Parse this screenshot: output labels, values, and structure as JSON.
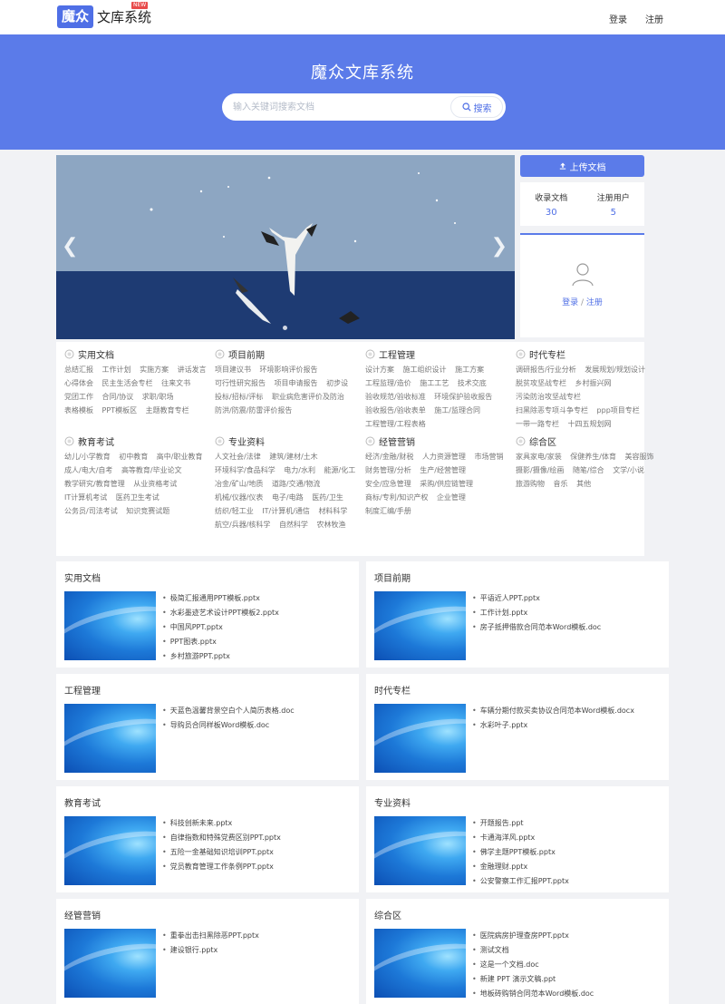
{
  "header": {
    "logo_box": "魔众",
    "logo_text": "文库系统",
    "logo_badge": "NEW",
    "login": "登录",
    "register": "注册"
  },
  "banner": {
    "title": "魔众文库系统",
    "search_placeholder": "输入关键词搜索文档",
    "search_button": "搜索"
  },
  "sidebar": {
    "upload_label": "上传文档",
    "stats": [
      {
        "label": "收录文档",
        "value": "30"
      },
      {
        "label": "注册用户",
        "value": "5"
      }
    ],
    "login_link": "登录",
    "register_link": "注册",
    "divider": " / "
  },
  "categories": [
    {
      "title": "实用文档",
      "items": [
        "总结汇报",
        "工作计划",
        "实施方案",
        "讲话发言",
        "心得体会",
        "民主生活会专栏",
        "往来文书",
        "党团工作",
        "合同/协议",
        "求职/职场",
        "表格模板",
        "PPT模板区",
        "主题教育专栏"
      ]
    },
    {
      "title": "项目前期",
      "items": [
        "项目建议书",
        "环境影响评价报告",
        "可行性研究报告",
        "项目申请报告",
        "初步设",
        "投标/招标/评标",
        "职业病危害评价及防治",
        "防洪/防震/防雷评价报告"
      ]
    },
    {
      "title": "工程管理",
      "items": [
        "设计方案",
        "施工组织设计",
        "施工方案",
        "工程监理/造价",
        "施工工艺",
        "技术交底",
        "验收规范/验收标准",
        "环境保护验收报告",
        "验收报告/验收表单",
        "施工/监理合同",
        "工程管理/工程表格"
      ]
    },
    {
      "title": "时代专栏",
      "items": [
        "调研报告/行业分析",
        "发展规划/规划设计",
        "脱贫攻坚战专栏",
        "乡村振兴网",
        "污染防治攻坚战专栏",
        "扫黑除恶专项斗争专栏",
        "ppp项目专栏",
        "一带一路专栏",
        "十四五规划网"
      ]
    },
    {
      "title": "教育考试",
      "items": [
        "幼儿/小学教育",
        "初中教育",
        "高中/职业教育",
        "成人/电大/自考",
        "高等教育/毕业论文",
        "教学研究/教育管理",
        "从业资格考试",
        "IT计算机考试",
        "医药卫生考试",
        "公务员/司法考试",
        "知识竞赛试题"
      ]
    },
    {
      "title": "专业资料",
      "items": [
        "人文社会/法律",
        "建筑/建材/土木",
        "环境科学/食品科学",
        "电力/水利",
        "能源/化工",
        "冶金/矿山/地质",
        "道路/交通/物流",
        "机械/仪器/仪表",
        "电子/电路",
        "医药/卫生",
        "纺织/轻工业",
        "IT/计算机/通信",
        "材料科学",
        "航空/兵器/核科学",
        "自然科学",
        "农林牧渔"
      ]
    },
    {
      "title": "经管营销",
      "items": [
        "经济/金融/财税",
        "人力资源管理",
        "市场营销",
        "财务管理/分析",
        "生产/经营管理",
        "安全/应急管理",
        "采购/供应链管理",
        "商标/专利/知识产权",
        "企业管理",
        "制度汇编/手册"
      ]
    },
    {
      "title": "综合区",
      "items": [
        "家具家电/家装",
        "保健养生/体育",
        "美容服饰",
        "摄影/摄像/绘画",
        "随笔/综合",
        "文学/小说",
        "旅游购物",
        "音乐",
        "其他"
      ]
    }
  ],
  "cards": [
    {
      "title": "实用文档",
      "docs": [
        "极简汇报通用PPT模板.pptx",
        "水彩墨迹艺术设计PPT模板2.pptx",
        "中国风PPT.pptx",
        "PPT图表.pptx",
        "乡村旅游PPT.pptx"
      ]
    },
    {
      "title": "项目前期",
      "docs": [
        "平语近人PPT.pptx",
        "工作计划.pptx",
        "房子抵押借款合同范本Word模板.doc"
      ]
    },
    {
      "title": "工程管理",
      "docs": [
        "天蓝色温馨背景空白个人简历表格.doc",
        "导购员合同样板Word模板.doc"
      ]
    },
    {
      "title": "时代专栏",
      "docs": [
        "车辆分期付款买卖协议合同范本Word模板.docx",
        "水彩叶子.pptx"
      ]
    },
    {
      "title": "教育考试",
      "docs": [
        "科技创新未来.pptx",
        "自律指数和特殊党费区别PPT.pptx",
        "五险一金基础知识培训PPT.pptx",
        "党员教育管理工作条例PPT.pptx"
      ]
    },
    {
      "title": "专业资料",
      "docs": [
        "开题报告.ppt",
        "卡通海洋风.pptx",
        "佛学主题PPT模板.pptx",
        "金融理财.pptx",
        "公安警察工作汇报PPT.pptx"
      ]
    },
    {
      "title": "经管营销",
      "docs": [
        "重拳出击扫黑除恶PPT.pptx",
        "建设银行.pptx"
      ]
    },
    {
      "title": "综合区",
      "docs": [
        "医院病房护理查房PPT.pptx",
        "测试文档",
        "这是一个文档.doc",
        "新建 PPT 演示文稿.ppt",
        "地板砖购销合同范本Word模板.doc"
      ]
    }
  ]
}
